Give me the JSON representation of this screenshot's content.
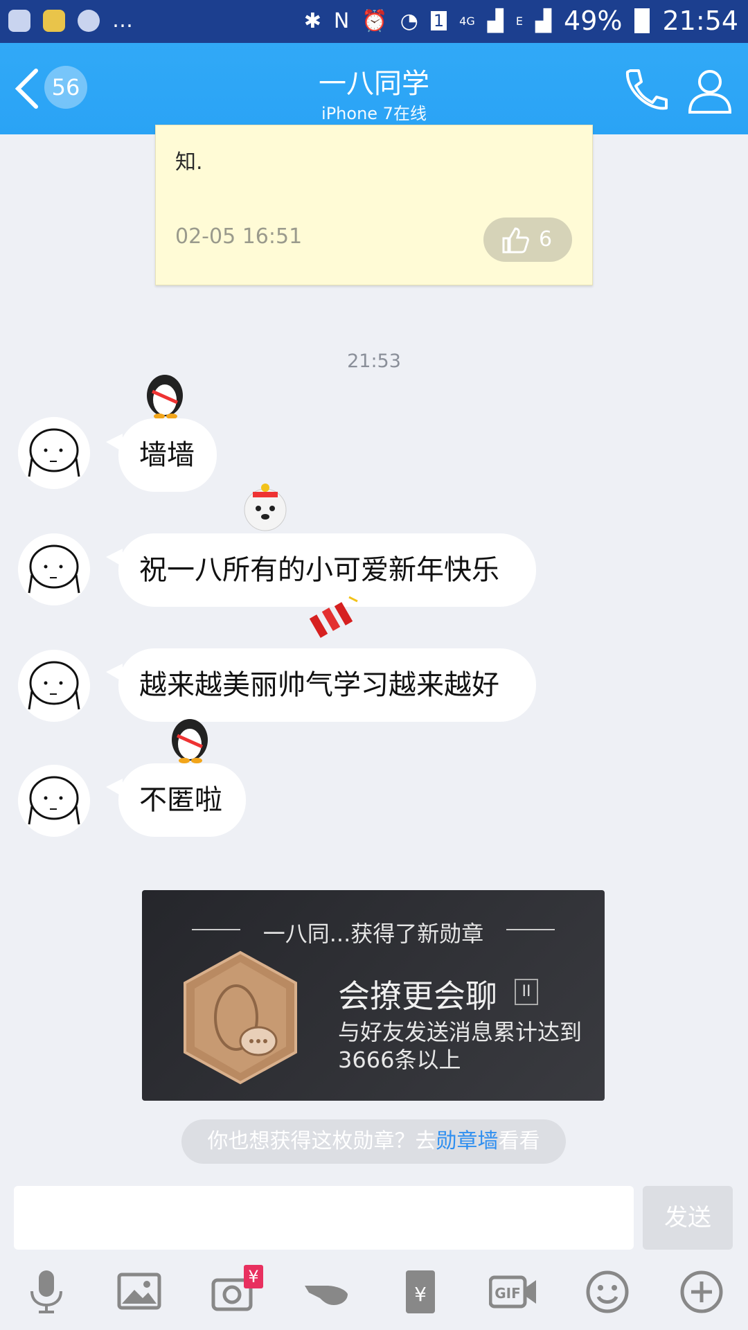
{
  "status_bar": {
    "battery": "49%",
    "time": "21:54",
    "network_4g": "4G",
    "network_e": "E",
    "sim": "1"
  },
  "header": {
    "unread_count": "56",
    "title": "一八同学",
    "subtitle": "iPhone 7在线"
  },
  "note": {
    "text_line1": "知.",
    "time": "02-05 16:51",
    "likes": "6"
  },
  "time_separator": "21:53",
  "messages": [
    {
      "text": "墙墙",
      "sticker": "penguin-icon"
    },
    {
      "text": "祝一八所有的小可爱新年快乐",
      "sticker": "polar-bear-icon"
    },
    {
      "text": "越来越美丽帅气学习越来越好",
      "sticker": "firecracker-icon"
    },
    {
      "text": "不匿啦",
      "sticker": "penguin-icon"
    }
  ],
  "medal_card": {
    "headline": "一八同...获得了新勋章",
    "name": "会撩更会聊",
    "level": "II",
    "description": "与好友发送消息累计达到3666条以上"
  },
  "tip": {
    "prefix": "你也想获得这枚勋章？去",
    "link": "勋章墙",
    "suffix": "看看"
  },
  "composer": {
    "send_label": "发送"
  },
  "toolbar": {
    "icons": [
      "microphone-icon",
      "image-icon",
      "camera-icon",
      "poke-icon",
      "red-packet-icon",
      "gif-icon",
      "emoji-icon",
      "plus-icon"
    ],
    "camera_badge": "¥"
  },
  "colors": {
    "header": "#2aa3f5",
    "status_bar": "#1c3f8f",
    "background": "#eef0f5",
    "link": "#2f8ff0"
  }
}
